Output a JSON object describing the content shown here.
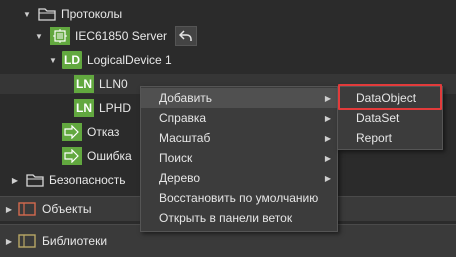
{
  "tree": {
    "protocols": "Протоколы",
    "server": "IEC61850 Server",
    "logical_device": "LogicalDevice 1",
    "ld_badge": "LD",
    "ln_badge": "LN",
    "lln0": "LLN0",
    "lphd": "LPHD",
    "response": "Отказ",
    "error": "Ошибка",
    "security": "Безопасность"
  },
  "panels": {
    "objects": "Объекты",
    "libraries": "Библиотеки"
  },
  "context_menu": {
    "items": [
      {
        "label": "Добавить",
        "has_submenu": true
      },
      {
        "label": "Справка",
        "has_submenu": true
      },
      {
        "label": "Масштаб",
        "has_submenu": true
      },
      {
        "label": "Поиск",
        "has_submenu": true
      },
      {
        "label": "Дерево",
        "has_submenu": true
      },
      {
        "label": "Восстановить по умолчанию",
        "has_submenu": false
      },
      {
        "label": "Открыть в панели веток",
        "has_submenu": false
      }
    ]
  },
  "submenu": {
    "items": [
      "DataObject",
      "DataSet",
      "Report"
    ]
  },
  "colors": {
    "badge_green": "#62a83f",
    "highlight_red": "#e23b3b",
    "background": "#2b2b2b"
  },
  "icons": [
    "folder-icon",
    "server-icon",
    "back-arrow-icon",
    "arrow-right-box-icon",
    "panel-icon",
    "chevron-right-icon",
    "chevron-down-icon"
  ]
}
